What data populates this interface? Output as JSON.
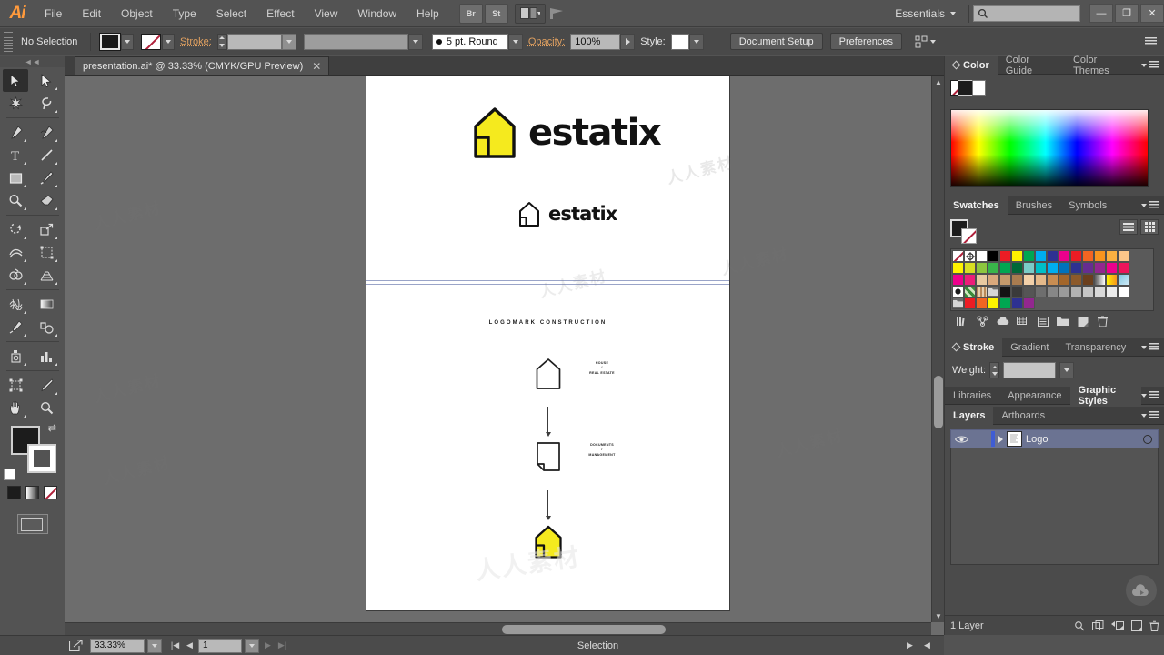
{
  "app": {
    "name": "Adobe Illustrator",
    "logo_text": "Ai",
    "menus": [
      "File",
      "Edit",
      "Object",
      "Type",
      "Select",
      "Effect",
      "View",
      "Window",
      "Help"
    ],
    "menu_icons": [
      "Br",
      "St"
    ],
    "workspace": "Essentials",
    "search_placeholder": "",
    "window_buttons": {
      "minimize": "—",
      "restore": "❐",
      "close": "✕"
    }
  },
  "control_bar": {
    "selection_status": "No Selection",
    "stroke_label": "Stroke:",
    "stroke_weight": "",
    "stroke_profile": "",
    "brush_definition": "5 pt. Round",
    "opacity_label": "Opacity:",
    "opacity_value": "100%",
    "style_label": "Style:",
    "document_setup": "Document Setup",
    "preferences": "Preferences"
  },
  "document": {
    "tab_title": "presentation.ai* @ 33.33% (CMYK/GPU Preview)",
    "close_label": "✕"
  },
  "artwork": {
    "logo_primary_text": "estatix",
    "logo_secondary_text": "estatix",
    "section_title": "LOGOMARK CONSTRUCTION",
    "steps": [
      {
        "label": "HOUSE\n/\nREAL ESTATE",
        "shape": "house-outline"
      },
      {
        "label": "DOCUMENTS\n/\nMANAGEMENT",
        "shape": "page-outline"
      },
      {
        "label": "",
        "shape": "house-filled-yellow"
      }
    ],
    "brand_yellow": "#f5ea1e",
    "brand_black": "#121212"
  },
  "panels": {
    "color": {
      "tabs": [
        "Color",
        "Color Guide",
        "Color Themes"
      ],
      "active_tab": "Color"
    },
    "swatches": {
      "tabs": [
        "Swatches",
        "Brushes",
        "Symbols"
      ],
      "active_tab": "Swatches",
      "rows": [
        [
          "none",
          "registration",
          "#ffffff",
          "#000000",
          "#ec1c24",
          "#fff200",
          "#00a651",
          "#00aeef",
          "#2e3192",
          "#ec008c",
          "#ed1c24",
          "#f26522",
          "#f7941e",
          "#fbb040",
          "#fdc689"
        ],
        [
          "#fff200",
          "#d7df23",
          "#8dc63f",
          "#39b54a",
          "#00a651",
          "#006838",
          "#7accc8",
          "#00c0c7",
          "#00aeef",
          "#0072bc",
          "#2e3192",
          "#662d91",
          "#92278f",
          "#ec008c",
          "#ed145b"
        ],
        [
          "#ec008c",
          "#ed1e79",
          "#e8c9a0",
          "#d9a87c",
          "#c49a6c",
          "#a97c50",
          "#f2d0a9",
          "#e4b98a",
          "#c88d52",
          "#a3662a",
          "#8c5a2b",
          "#6b3f1d",
          "#e9e9e9",
          "#f6e27a",
          "#7ec8e3"
        ],
        [
          "pattern-dot",
          "pattern-leaf",
          "pattern-grain"
        ],
        [
          "folder",
          "#141414",
          "#3a3a3a",
          "#555555",
          "#6e6e6e",
          "#878787",
          "#9b9b9b",
          "#b2b2b2",
          "#c6c6c6",
          "#d8d8d8",
          "#ebebeb",
          "#ffffff"
        ],
        [
          "folder",
          "#ec1c24",
          "#f26522",
          "#fff200",
          "#00a651",
          "#2e3192",
          "#92278f"
        ]
      ]
    },
    "stroke": {
      "tabs": [
        "Stroke",
        "Gradient",
        "Transparency"
      ],
      "active_tab": "Stroke",
      "weight_label": "Weight:",
      "weight_value": ""
    },
    "styles": {
      "tabs": [
        "Libraries",
        "Appearance",
        "Graphic Styles"
      ],
      "active_tab": "Graphic Styles"
    },
    "layers": {
      "tabs": [
        "Layers",
        "Artboards"
      ],
      "active_tab": "Layers",
      "rows": [
        {
          "name": "Logo",
          "visible": true,
          "selected": true
        }
      ],
      "footer_count": "1 Layer"
    }
  },
  "status_bar": {
    "zoom": "33.33%",
    "artboard_number": "1",
    "status_text": "Selection"
  },
  "tools": [
    {
      "name": "selection-tool",
      "active": true
    },
    {
      "name": "direct-selection-tool",
      "active": false
    },
    {
      "name": "magic-wand-tool",
      "active": false
    },
    {
      "name": "lasso-tool",
      "active": false
    },
    {
      "name": "pen-tool",
      "active": false
    },
    {
      "name": "curvature-tool",
      "active": false
    },
    {
      "name": "type-tool",
      "active": false
    },
    {
      "name": "line-segment-tool",
      "active": false
    },
    {
      "name": "rectangle-tool",
      "active": false
    },
    {
      "name": "paintbrush-tool",
      "active": false
    },
    {
      "name": "shaper-tool",
      "active": false
    },
    {
      "name": "eraser-tool",
      "active": false
    },
    {
      "name": "rotate-tool",
      "active": false
    },
    {
      "name": "scale-tool",
      "active": false
    },
    {
      "name": "width-tool",
      "active": false
    },
    {
      "name": "free-transform-tool",
      "active": false
    },
    {
      "name": "shape-builder-tool",
      "active": false
    },
    {
      "name": "perspective-grid-tool",
      "active": false
    },
    {
      "name": "mesh-tool",
      "active": false
    },
    {
      "name": "gradient-tool",
      "active": false
    },
    {
      "name": "eyedropper-tool",
      "active": false
    },
    {
      "name": "blend-tool",
      "active": false
    },
    {
      "name": "symbol-sprayer-tool",
      "active": false
    },
    {
      "name": "column-graph-tool",
      "active": false
    },
    {
      "name": "artboard-tool",
      "active": false
    },
    {
      "name": "slice-tool",
      "active": false
    },
    {
      "name": "hand-tool",
      "active": false
    },
    {
      "name": "zoom-tool",
      "active": false
    }
  ],
  "watermark": {
    "text": "人人素材"
  }
}
